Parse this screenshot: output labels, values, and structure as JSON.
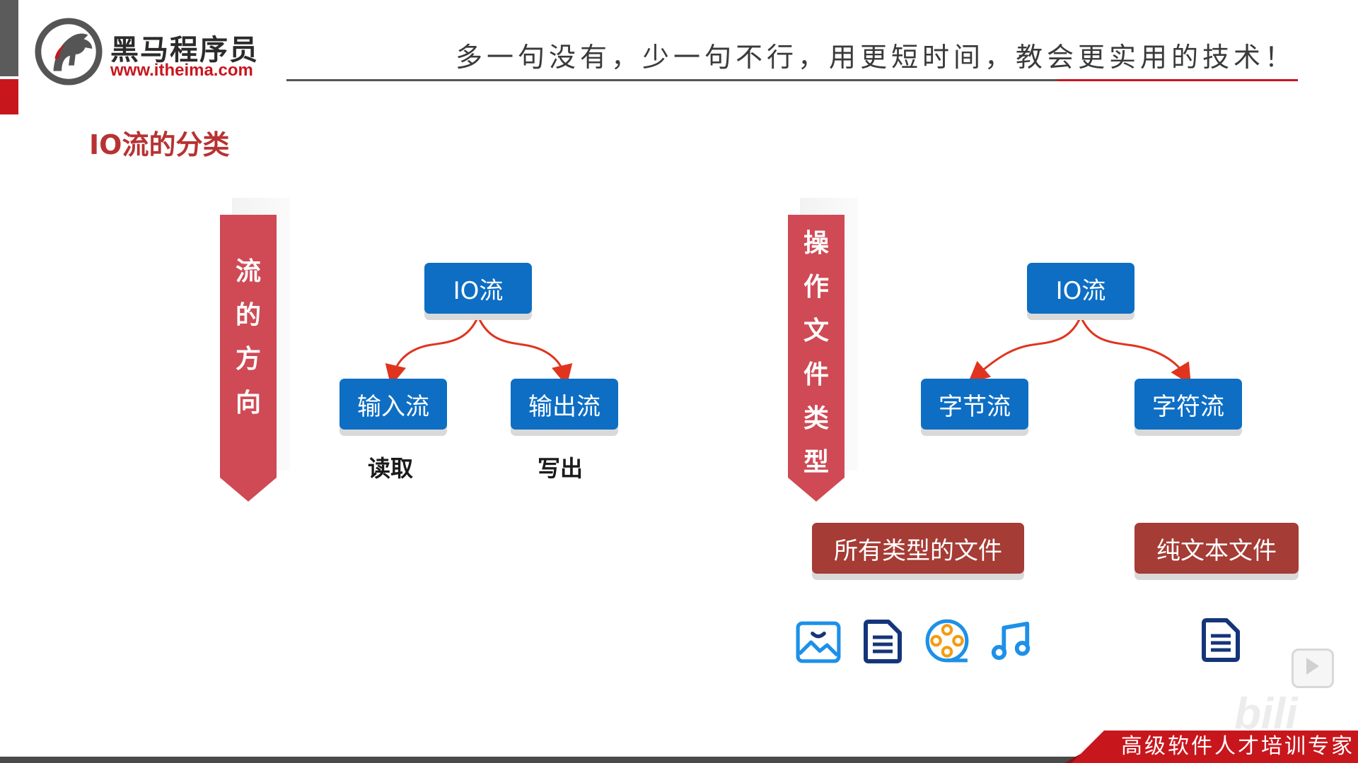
{
  "header": {
    "brand_name": "黑马程序员",
    "brand_url": "www.itheima.com",
    "slogan": "多一句没有，少一句不行，用更短时间，教会更实用的技术！"
  },
  "section_title": "IO流的分类",
  "direction": {
    "ribbon_chars": [
      "流",
      "的",
      "方",
      "向"
    ],
    "root": "IO流",
    "left_child": "输入流",
    "right_child": "输出流",
    "left_caption": "读取",
    "right_caption": "写出"
  },
  "file_type": {
    "ribbon_chars": [
      "操",
      "作",
      "文",
      "件",
      "类",
      "型"
    ],
    "root": "IO流",
    "left_child": "字节流",
    "right_child": "字符流",
    "left_desc": "所有类型的文件",
    "right_desc": "纯文本文件",
    "left_icons": [
      "image-icon",
      "document-icon",
      "film-reel-icon",
      "music-note-icon"
    ],
    "right_icons": [
      "document-icon"
    ]
  },
  "footer": {
    "tagline": "高级软件人才培训专家"
  },
  "colors": {
    "brand_red": "#c8161d",
    "ribbon_red": "#cf4a55",
    "box_blue": "#0d6ec4",
    "box_brown": "#a53c35",
    "icon_blue": "#1e90e8",
    "icon_navy": "#14357a",
    "icon_orange": "#f39c12"
  }
}
